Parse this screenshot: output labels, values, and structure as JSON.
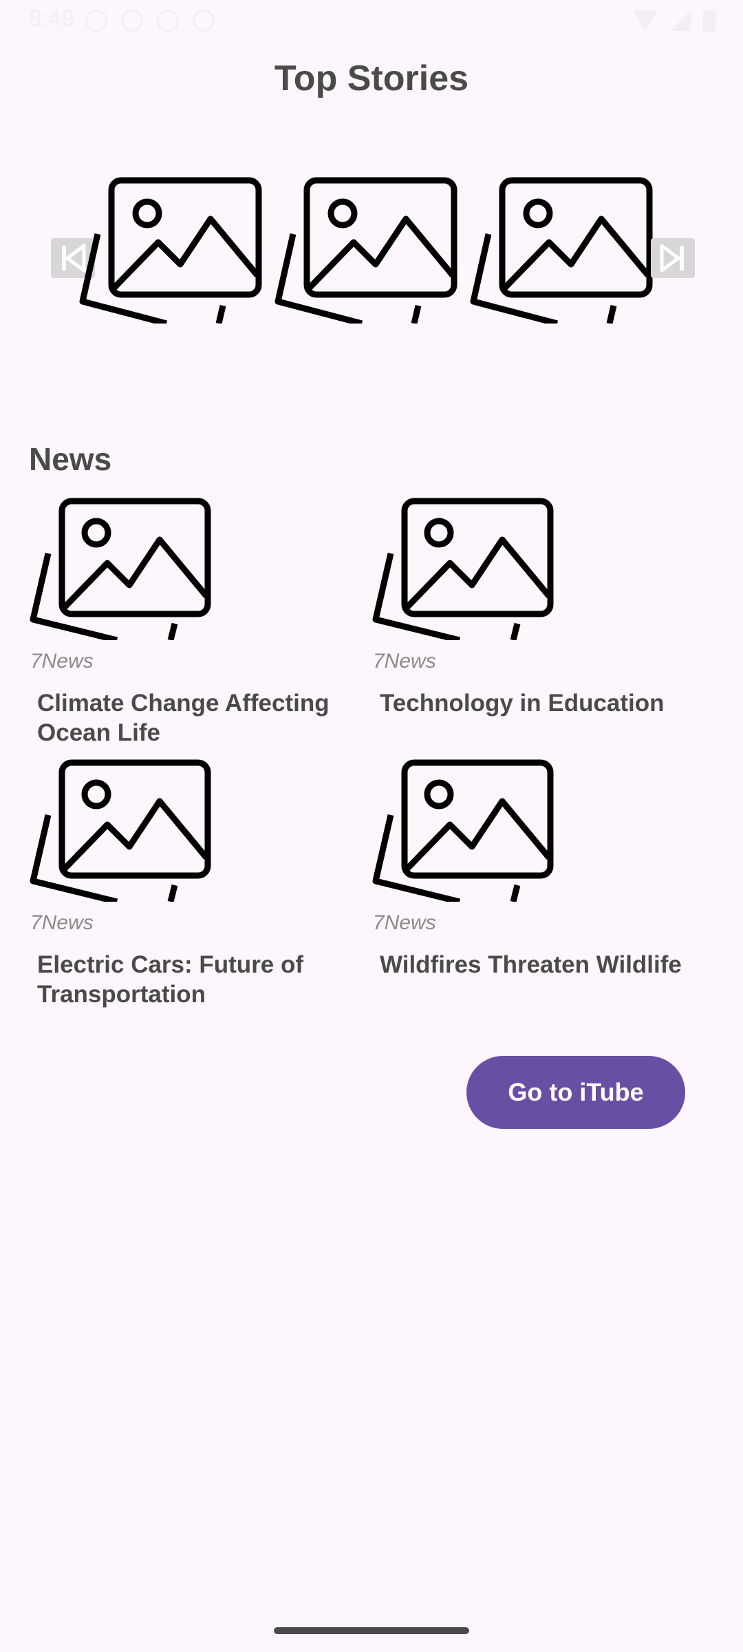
{
  "status_bar": {
    "time": "8:49"
  },
  "header": {
    "title": "Top Stories"
  },
  "carousel": {
    "items": [
      {
        "icon": "image-placeholder-icon"
      },
      {
        "icon": "image-placeholder-icon"
      },
      {
        "icon": "image-placeholder-icon"
      }
    ],
    "prev_icon": "skip-previous-icon",
    "next_icon": "skip-next-icon"
  },
  "news": {
    "section_title": "News",
    "articles": [
      {
        "source": "7News",
        "title_line1": "Climate Change Affecting",
        "title_line2": "Ocean Life"
      },
      {
        "source": "7News",
        "title_line1": "Technology in Education",
        "title_line2": ""
      },
      {
        "source": "7News",
        "title_line1": "Electric Cars: Future of",
        "title_line2": "Transportation"
      },
      {
        "source": "7News",
        "title_line1": "Wildfires Threaten Wildlife",
        "title_line2": ""
      }
    ]
  },
  "actions": {
    "itube_label": "Go to iTube"
  },
  "colors": {
    "background": "#FDF6FC",
    "accent": "#6750A4",
    "text": "#4A4A4A",
    "muted": "#8A8A8A"
  }
}
